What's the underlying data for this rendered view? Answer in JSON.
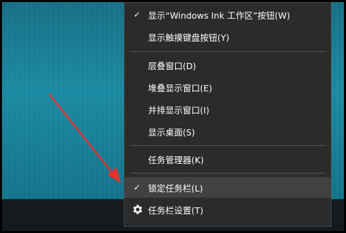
{
  "context_menu": {
    "items": [
      {
        "label": "显示“Windows Ink 工作区”按钮(W)",
        "checked": true
      },
      {
        "label": "显示触摸键盘按钮(Y)",
        "checked": false
      },
      {
        "label": "层叠窗口(D)",
        "checked": false
      },
      {
        "label": "堆叠显示窗口(E)",
        "checked": false
      },
      {
        "label": "并排显示窗口(I)",
        "checked": false
      },
      {
        "label": "显示桌面(S)",
        "checked": false
      },
      {
        "label": "任务管理器(K)",
        "checked": false
      },
      {
        "label": "锁定任务栏(L)",
        "checked": true
      },
      {
        "label": "任务栏设置(T)",
        "icon": "gear-icon"
      }
    ],
    "check_glyph": "✓"
  },
  "annotation": {
    "color": "#e8322e"
  }
}
